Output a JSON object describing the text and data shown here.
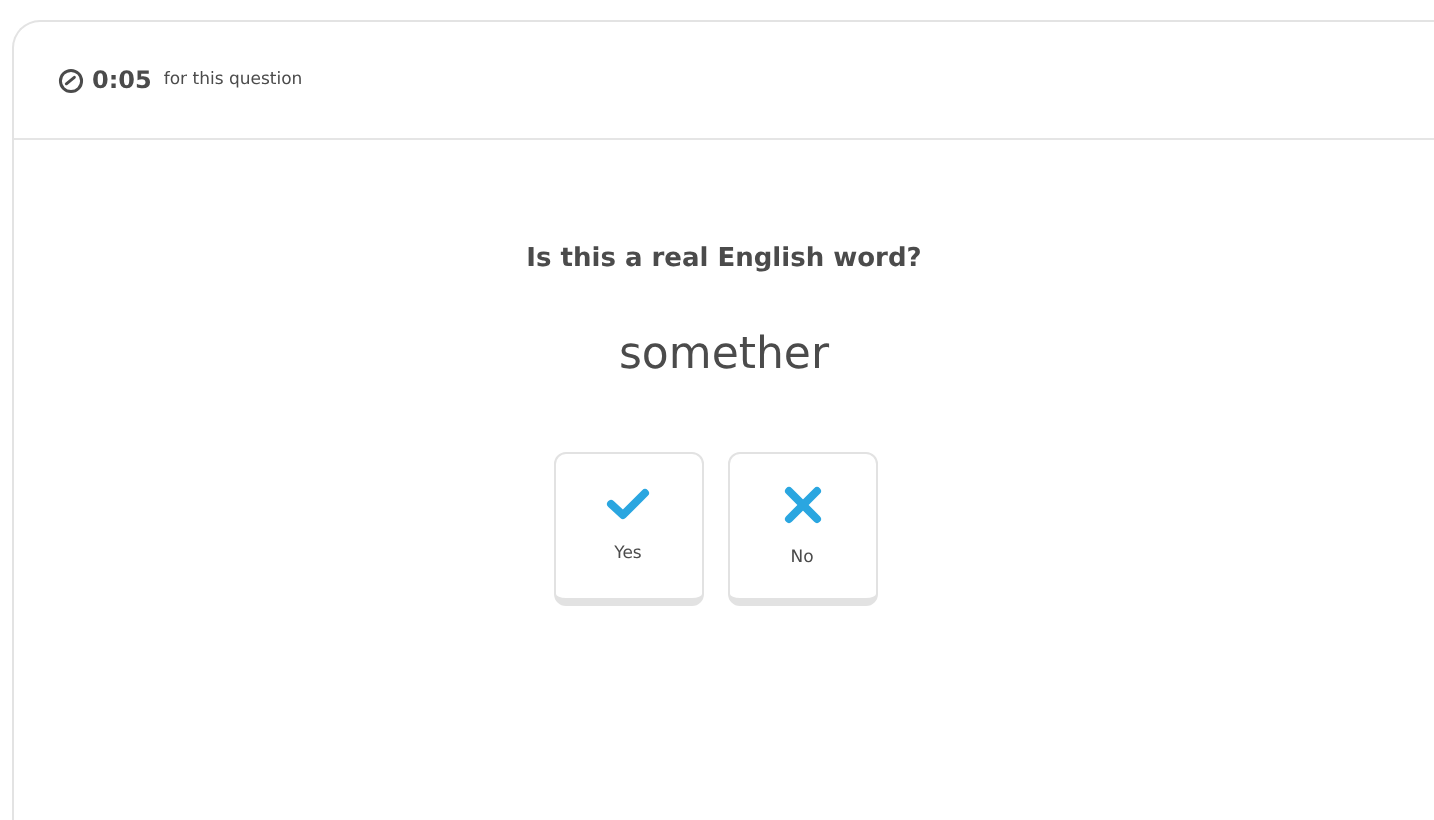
{
  "timer": {
    "time": "0:05",
    "label": "for this question"
  },
  "question": "Is this a real English word?",
  "word": "somether",
  "answers": [
    {
      "kind": "yes",
      "label": "Yes"
    },
    {
      "kind": "no",
      "label": "No"
    }
  ]
}
